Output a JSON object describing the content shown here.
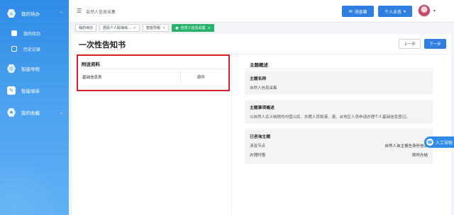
{
  "sidebar": {
    "items": [
      {
        "label": "我的待办",
        "icon": "home-icon"
      },
      {
        "label": "智能导税",
        "icon": "compass-icon"
      },
      {
        "label": "智能填单",
        "icon": "form-icon"
      },
      {
        "label": "我的收藏",
        "icon": "star-icon"
      }
    ],
    "subitems": [
      {
        "label": "我的待办"
      },
      {
        "label": "历史记录"
      }
    ]
  },
  "topbar": {
    "title": "自然人信息采集",
    "message_label": "消息箱",
    "business_label": "个人业务"
  },
  "tabs": [
    {
      "label": "我的待办"
    },
    {
      "label": "居民个人取得综..."
    },
    {
      "label": "智能导税"
    },
    {
      "label": "自然人信息采集"
    }
  ],
  "page": {
    "title": "一次性告知书",
    "prev_label": "上一步",
    "next_label": "下一步"
  },
  "attachments": {
    "heading": "附送资料",
    "rows": [
      {
        "name": "基础信息表",
        "type": "原件"
      }
    ]
  },
  "overview": {
    "heading": "主题概述",
    "name_label": "主题名称",
    "name_value": "自然人信息采集",
    "desc_label": "主题事项概述",
    "desc_value": "以自然人名义纳税的中国公民、外籍人员和港、澳、台地区人员申请办理个人基础信息登记。",
    "selected_label": "已咨询主题",
    "rows": [
      {
        "k": "涉及节点",
        "v": "自然人自主报告身份信息"
      },
      {
        "k": "办理时限",
        "v": "即时办结"
      }
    ]
  },
  "float_nav": {
    "label": "人工导税"
  },
  "colors": {
    "primary": "#2f7fe0",
    "sidebar": "#2f8be6",
    "active_tab": "#28b36b",
    "highlight": "#d4232f"
  }
}
